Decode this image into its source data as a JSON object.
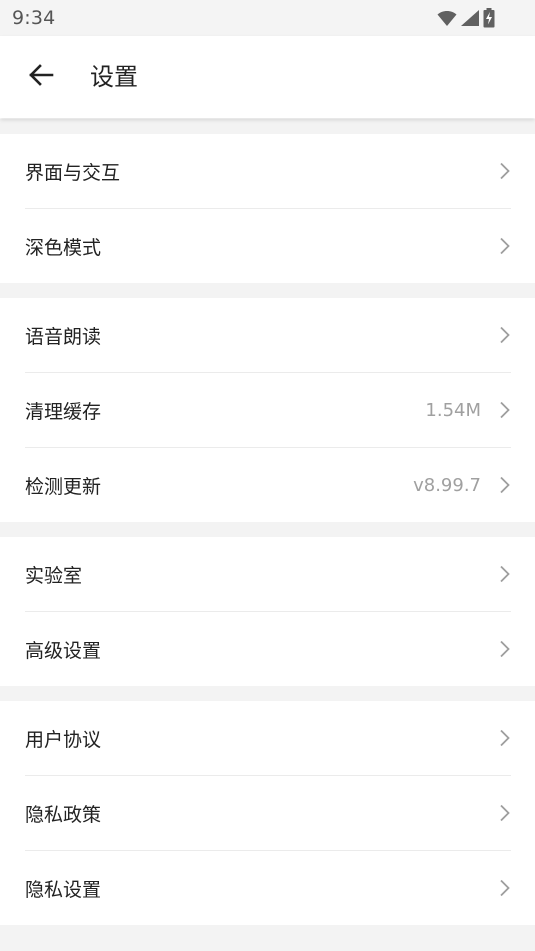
{
  "status_bar": {
    "time": "9:34",
    "icons": [
      "wifi-icon",
      "cellular-signal-icon",
      "battery-charging-icon"
    ]
  },
  "app_bar": {
    "back_icon": "arrow-left-icon",
    "title": "设置"
  },
  "groups": [
    {
      "items": [
        {
          "label": "界面与交互",
          "value": ""
        },
        {
          "label": "深色模式",
          "value": ""
        }
      ]
    },
    {
      "items": [
        {
          "label": "语音朗读",
          "value": ""
        },
        {
          "label": "清理缓存",
          "value": "1.54M"
        },
        {
          "label": "检测更新",
          "value": "v8.99.7"
        }
      ]
    },
    {
      "items": [
        {
          "label": "实验室",
          "value": ""
        },
        {
          "label": "高级设置",
          "value": ""
        }
      ]
    },
    {
      "items": [
        {
          "label": "用户协议",
          "value": ""
        },
        {
          "label": "隐私政策",
          "value": ""
        },
        {
          "label": "隐私设置",
          "value": ""
        }
      ]
    }
  ],
  "colors": {
    "background": "#f3f3f3",
    "surface": "#ffffff",
    "text_primary": "#222222",
    "text_secondary": "#a0a0a0",
    "chevron": "#9e9e9e"
  }
}
